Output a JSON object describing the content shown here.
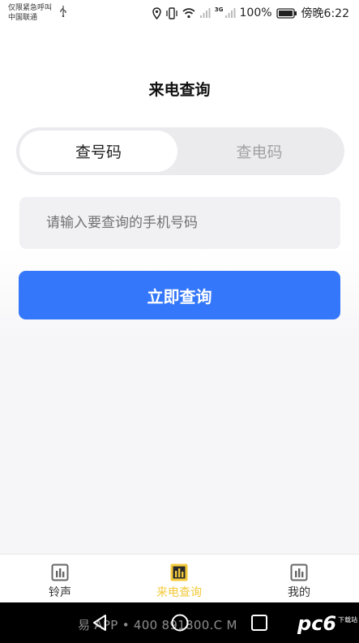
{
  "status_bar": {
    "carrier_line1": "仅限紧急呼叫",
    "carrier_line2": "中国联通",
    "network": "3G",
    "battery": "100%",
    "time": "傍晚6:22"
  },
  "page": {
    "title": "来电查询"
  },
  "segment": {
    "tabs": [
      {
        "label": "查号码"
      },
      {
        "label": "查电码"
      }
    ]
  },
  "search": {
    "placeholder": "请输入要查询的手机号码",
    "value": ""
  },
  "actions": {
    "query_label": "立即查询"
  },
  "tab_bar": {
    "items": [
      {
        "label": "铃声"
      },
      {
        "label": "来电查询"
      },
      {
        "label": "我的"
      }
    ],
    "active_color": "#f3c93a"
  },
  "watermark": {
    "text": "易      APP • 400   891800.C   M",
    "logo_text": "pc6",
    "logo_small": "下载站"
  },
  "colors": {
    "accent": "#3477fb"
  }
}
